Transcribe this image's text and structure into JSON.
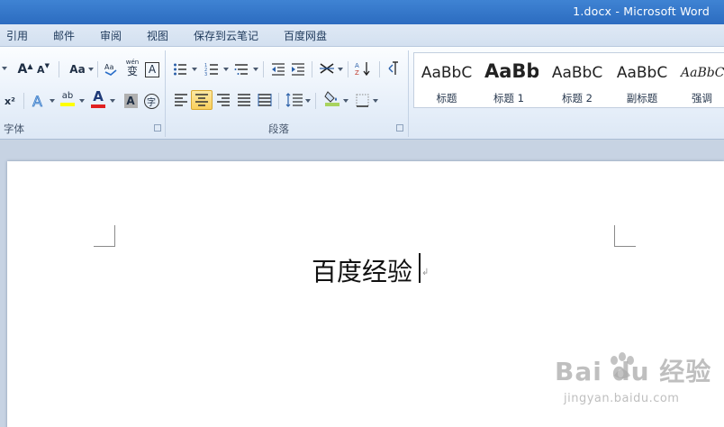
{
  "window": {
    "title": "1.docx  -  Microsoft Word"
  },
  "tabs": [
    "引用",
    "邮件",
    "审阅",
    "视图",
    "保存到云笔记",
    "百度网盘"
  ],
  "ribbon": {
    "font_group_label": "字体",
    "paragraph_group_label": "段落",
    "font_buttons": {
      "grow": "A",
      "shrink": "A",
      "change_case": "Aa",
      "phonetic": "wén",
      "phonetic_char": "变",
      "border_char": "A",
      "superscript": "x²",
      "highlight_text": "ab",
      "font_color_text": "A",
      "shading_char": "A",
      "enclose_char": "字"
    },
    "styles": [
      {
        "sample": "AaBbC",
        "name": "标题"
      },
      {
        "sample": "AaBb",
        "name": "标题 1"
      },
      {
        "sample": "AaBbC",
        "name": "标题 2"
      },
      {
        "sample": "AaBbC",
        "name": "副标题"
      },
      {
        "sample": "AaBbCcI",
        "name": "强调"
      }
    ]
  },
  "document": {
    "text": "百度经验",
    "para_mark": "↲"
  },
  "watermark": {
    "brand": "Bai du 经验",
    "url": "jingyan.baidu.com"
  },
  "colors": {
    "highlight": "#ffff00",
    "font_color": "#e02020",
    "accent": "#2c6cc0"
  }
}
